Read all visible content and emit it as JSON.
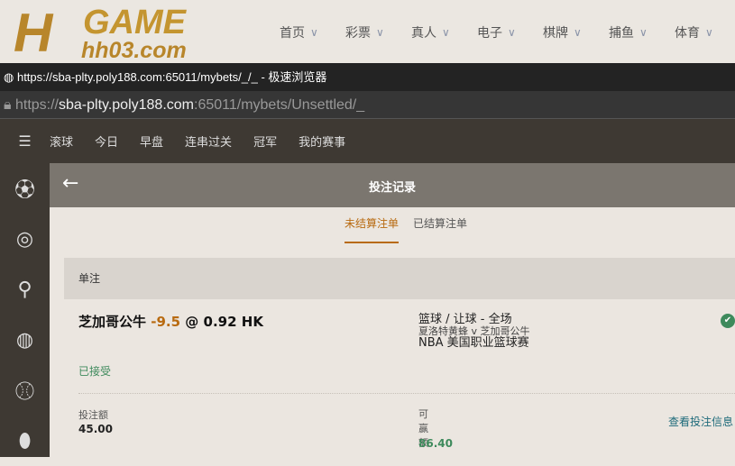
{
  "site": {
    "logo_letters": "H",
    "logo_game": "GAME",
    "logo_domain": "hh03.com",
    "nav": [
      {
        "label": "首页"
      },
      {
        "label": "彩票"
      },
      {
        "label": "真人"
      },
      {
        "label": "电子"
      },
      {
        "label": "棋牌"
      },
      {
        "label": "捕鱼"
      },
      {
        "label": "体育"
      }
    ]
  },
  "browser": {
    "title": "https://sba-plty.poly188.com:65011/mybets/_/_ - 极速浏览器",
    "url_scheme": "https://",
    "url_host": "sba-plty.poly188.com",
    "url_rest": ":65011/mybets/Unsettled/_"
  },
  "sportsnav": [
    "滚球",
    "今日",
    "早盘",
    "连串过关",
    "冠军",
    "我的赛事"
  ],
  "sidebar_icons": [
    "soccer-icon",
    "basketball-icon",
    "tennis-icon",
    "volleyball-icon",
    "baseball-icon",
    "football-icon"
  ],
  "header": {
    "title": "投注记录"
  },
  "tabs": {
    "unsettled": "未结算注单",
    "settled": "已结算注单"
  },
  "section": "单注",
  "bet": {
    "team": "芝加哥公牛",
    "handicap": "-9.5",
    "at": "@",
    "odds": "0.92 HK",
    "market": "篮球 / 让球 - 全场",
    "match": "夏洛特黄蜂 v 芝加哥公牛",
    "league": "NBA 美国职业篮球赛",
    "status": "已接受",
    "stake_label": "投注额",
    "stake": "45.00",
    "win_label": "可赢额",
    "win": "86.40",
    "details_link": "查看投注信息"
  },
  "colors": {
    "accent": "#b86a10",
    "success": "#3e8a5c",
    "link": "#1d6a7a"
  }
}
